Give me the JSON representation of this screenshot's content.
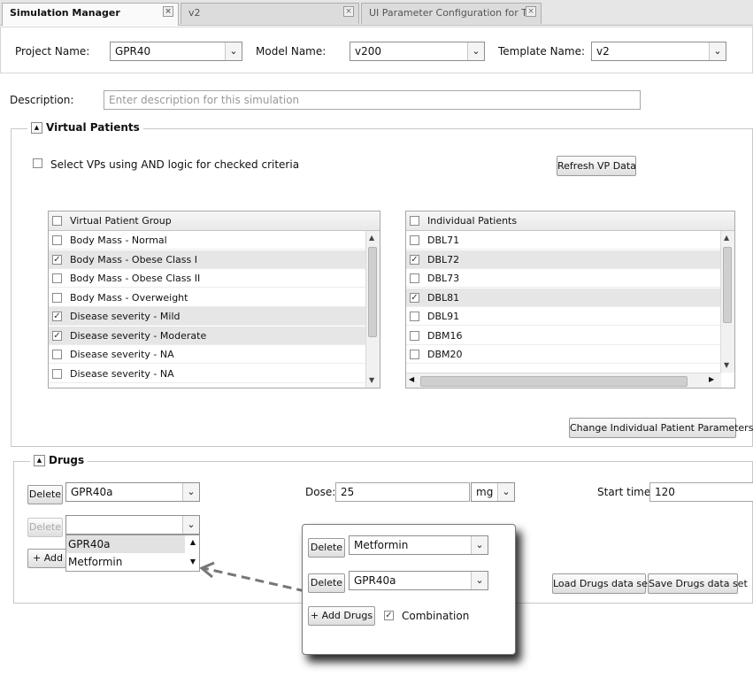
{
  "tabs": [
    {
      "label": "Simulation Manager"
    },
    {
      "label": "v2"
    },
    {
      "label": "UI Parameter Configuration for T..."
    }
  ],
  "header": {
    "project_label": "Project Name:",
    "project_value": "GPR40",
    "model_label": "Model Name:",
    "model_value": "v200",
    "template_label": "Template Name:",
    "template_value": "v2",
    "description_label": "Description:",
    "description_placeholder": "Enter description for this simulation"
  },
  "virtual_patients": {
    "legend": "Virtual Patients",
    "and_logic_label": "Select VPs using AND logic for checked criteria",
    "refresh_button": "Refresh VP Data",
    "group_grid": {
      "header": "Virtual Patient Group",
      "rows": [
        {
          "label": "Body Mass - Normal",
          "checked": false
        },
        {
          "label": "Body Mass - Obese Class I",
          "checked": true
        },
        {
          "label": "Body Mass - Obese Class II",
          "checked": false
        },
        {
          "label": "Body Mass - Overweight",
          "checked": false
        },
        {
          "label": "Disease severity - Mild",
          "checked": true
        },
        {
          "label": "Disease severity - Moderate",
          "checked": true
        },
        {
          "label": "Disease severity - NA",
          "checked": false
        },
        {
          "label": "Disease severity - NA",
          "checked": false
        }
      ]
    },
    "individual_grid": {
      "header": "Individual Patients",
      "rows": [
        {
          "label": "DBL71",
          "checked": false
        },
        {
          "label": "DBL72",
          "checked": true
        },
        {
          "label": "DBL73",
          "checked": false
        },
        {
          "label": "DBL81",
          "checked": true
        },
        {
          "label": "DBL91",
          "checked": false
        },
        {
          "label": "DBM16",
          "checked": false
        },
        {
          "label": "DBM20",
          "checked": false
        }
      ]
    },
    "change_params_button": "Change Individual Patient Parameters"
  },
  "drugs": {
    "legend": "Drugs",
    "delete_label": "Delete",
    "drug1_value": "GPR40a",
    "dose_label": "Dose:",
    "dose_value": "25",
    "unit_value": "mg",
    "start_label": "Start time:",
    "start_value": "120",
    "add_drugs_label": "+ Add D",
    "dropdown_options": [
      "GPR40a",
      "Metformin"
    ],
    "load_button": "Load Drugs data set",
    "save_button": "Save Drugs data set"
  },
  "zoom_panel": {
    "delete_label": "Delete",
    "drug_a": "Metformin",
    "drug_b": "GPR40a",
    "add_drugs": "+ Add Drugs",
    "combination_label": "Combination",
    "combination_checked": true
  },
  "icons": {
    "dropdown": "chevron-down-icon",
    "close": "close-icon",
    "collapse": "collapse-up-icon",
    "check": "checkmark-icon"
  }
}
